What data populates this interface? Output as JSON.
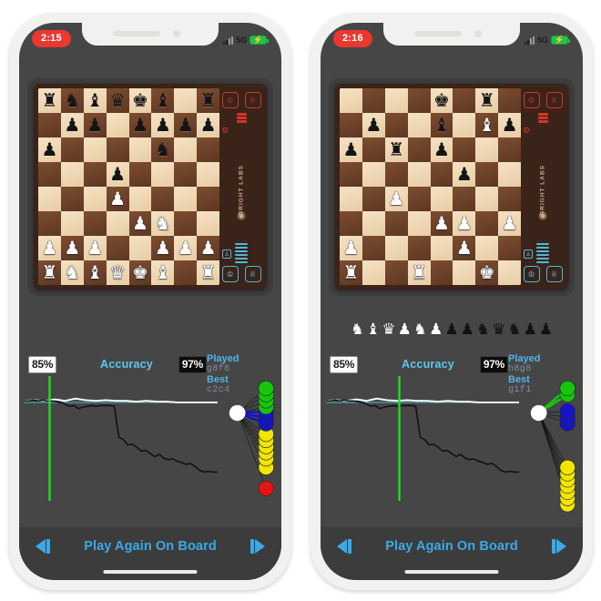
{
  "app": {
    "title": "Chess Game Analysis",
    "background_color": "#ffffff",
    "screen_color": "#464646",
    "accent_color": "#3aa9e8",
    "board_brand": "BRIGHT LABS"
  },
  "phones": [
    {
      "id": "left",
      "status_bar": {
        "time": "2:15",
        "time_pill_color": "#e8382f",
        "network": "5G",
        "battery_icon": "battery-charging-icon",
        "battery_color": "#25c24b",
        "signal_icon": "signal-bars-icon"
      },
      "board": {
        "brand": "BRIGHT LABS",
        "top_leds": [
          "black-king-led",
          "black-queen-led"
        ],
        "bottom_leds": [
          "white-king-led",
          "white-queen-led"
        ],
        "rows": [
          [
            "r",
            "n",
            "b",
            "q",
            "k",
            "b",
            "",
            "r"
          ],
          [
            "",
            "p",
            "p",
            "",
            "p",
            "p",
            "p",
            "p"
          ],
          [
            "p",
            "",
            "",
            "",
            "",
            "n",
            "",
            ""
          ],
          [
            "",
            "",
            "",
            "p",
            "",
            "",
            "",
            ""
          ],
          [
            "",
            "",
            "",
            "P",
            "",
            "",
            "",
            ""
          ],
          [
            "",
            "",
            "",
            "",
            "P",
            "N",
            "",
            ""
          ],
          [
            "P",
            "P",
            "P",
            "",
            "",
            "P",
            "P",
            "P"
          ],
          [
            "R",
            "N",
            "B",
            "Q",
            "K",
            "B",
            "",
            "R"
          ]
        ]
      },
      "captured": [],
      "analysis": {
        "white_accuracy": "85%",
        "black_accuracy": "97%",
        "accuracy_label": "Accuracy",
        "played_label": "Played",
        "played_move": "g8f6",
        "best_label": "Best",
        "best_move": "c2c4",
        "marker_position_pct": 13,
        "marker_color": "#22dd22",
        "zero_line_color": "#4aa9b5"
      },
      "chart_data": {
        "type": "line",
        "title": "Accuracy",
        "xlabel": "",
        "ylabel": "Evaluation",
        "ylim": [
          -1,
          1
        ],
        "grid": false,
        "legend_position": "none",
        "annotations": [
          {
            "text": "85%",
            "type": "white-accuracy-badge"
          },
          {
            "text": "97%",
            "type": "black-accuracy-badge"
          }
        ],
        "series": [
          {
            "name": "white-eval-line",
            "color": "#ffffff",
            "values": [
              0.02,
              0.03,
              0.02,
              0.04,
              0.02,
              0.05,
              0.03,
              0.02,
              0.03,
              0.02,
              0.02,
              0.01,
              0.02,
              0.01,
              0.01,
              0.0,
              0.0,
              0.0,
              0.0,
              0.0
            ]
          },
          {
            "name": "engine-eval-line",
            "color": "#101010",
            "values": [
              0.02,
              0.02,
              0.03,
              0.02,
              0.03,
              0.02,
              0.02,
              0.01,
              0.0,
              -0.02,
              -0.05,
              -0.04,
              -0.08,
              -0.06,
              -0.05,
              -0.04,
              -0.05,
              -0.04,
              -0.04,
              -0.04,
              -0.05,
              -0.45,
              -0.48,
              -0.55,
              -0.54,
              -0.58,
              -0.63,
              -0.62,
              -0.66,
              -0.7,
              -0.67,
              -0.72,
              -0.74,
              -0.73,
              -0.76,
              -0.78,
              -0.8,
              -0.79,
              -0.83,
              -0.88,
              -0.9,
              -0.89,
              -0.9,
              -0.9
            ]
          }
        ],
        "zero_line": 0
      },
      "move_tree": {
        "root_color": "#ffffff",
        "nodes": [
          {
            "color": "#16c60c",
            "label": "excellent",
            "count": 4,
            "cluster": "top"
          },
          {
            "color": "#1414c8",
            "label": "good",
            "count": 3,
            "cluster": "upper"
          },
          {
            "color": "#f2e500",
            "label": "inaccuracy",
            "count": 5,
            "cluster": "middle"
          },
          {
            "color": "#f2e500",
            "label": "inaccuracy",
            "count": 1,
            "cluster": "lower"
          },
          {
            "color": "#e81313",
            "label": "blunder",
            "count": 1,
            "cluster": "bottom"
          }
        ],
        "highlight_edge_color": "#1414c8"
      },
      "bottom_bar": {
        "prev_label": "step-back",
        "play_label": "Play Again On Board",
        "next_label": "step-forward"
      }
    },
    {
      "id": "right",
      "status_bar": {
        "time": "2:16",
        "time_pill_color": "#e8382f",
        "network": "5G",
        "battery_icon": "battery-charging-icon",
        "battery_color": "#25c24b",
        "signal_icon": "signal-bars-icon"
      },
      "board": {
        "brand": "BRIGHT LABS",
        "top_leds": [
          "black-king-led",
          "black-queen-led"
        ],
        "bottom_leds": [
          "white-king-led",
          "white-queen-led"
        ],
        "rows": [
          [
            "",
            "",
            "",
            "",
            "k",
            "",
            "r",
            ""
          ],
          [
            "",
            "p",
            "",
            "",
            "b",
            "",
            "B",
            "p"
          ],
          [
            "p",
            "",
            "r",
            "",
            "p",
            "",
            "",
            ""
          ],
          [
            "",
            "",
            "",
            "",
            "",
            "p",
            "",
            ""
          ],
          [
            "",
            "",
            "P",
            "",
            "",
            "",
            "",
            ""
          ],
          [
            "",
            "",
            "",
            "",
            "P",
            "P",
            "",
            "P"
          ],
          [
            "P",
            "",
            "",
            "",
            "",
            "P",
            "",
            ""
          ],
          [
            "R",
            "",
            "",
            "R",
            "",
            "",
            "K",
            ""
          ]
        ]
      },
      "captured": [
        {
          "piece": "white-knight",
          "glyph": "N"
        },
        {
          "piece": "white-bishop",
          "glyph": "B"
        },
        {
          "piece": "white-queen",
          "glyph": "Q"
        },
        {
          "piece": "white-pawn",
          "glyph": "P"
        },
        {
          "piece": "white-knight",
          "glyph": "N"
        },
        {
          "piece": "white-pawn",
          "glyph": "P"
        },
        {
          "piece": "black-pawn",
          "glyph": "p"
        },
        {
          "piece": "black-pawn",
          "glyph": "p"
        },
        {
          "piece": "black-knight",
          "glyph": "n"
        },
        {
          "piece": "black-queen",
          "glyph": "q"
        },
        {
          "piece": "black-knight",
          "glyph": "n"
        },
        {
          "piece": "black-pawn",
          "glyph": "p"
        },
        {
          "piece": "black-pawn",
          "glyph": "p"
        }
      ],
      "analysis": {
        "white_accuracy": "85%",
        "black_accuracy": "97%",
        "accuracy_label": "Accuracy",
        "played_label": "Played",
        "played_move": "h8g8",
        "best_label": "Best",
        "best_move": "g1f1",
        "marker_position_pct": 38,
        "marker_color": "#22dd22",
        "zero_line_color": "#4aa9b5"
      },
      "chart_data": {
        "type": "line",
        "title": "Accuracy",
        "xlabel": "",
        "ylabel": "Evaluation",
        "ylim": [
          -1,
          1
        ],
        "grid": false,
        "legend_position": "none",
        "annotations": [
          {
            "text": "85%",
            "type": "white-accuracy-badge"
          },
          {
            "text": "97%",
            "type": "black-accuracy-badge"
          }
        ],
        "series": [
          {
            "name": "white-eval-line",
            "color": "#ffffff",
            "values": [
              0.02,
              0.03,
              0.02,
              0.04,
              0.02,
              0.05,
              0.03,
              0.02,
              0.03,
              0.02,
              0.02,
              0.01,
              0.02,
              0.01,
              0.01,
              0.0,
              0.0,
              0.0,
              0.0,
              0.0
            ]
          },
          {
            "name": "engine-eval-line",
            "color": "#101010",
            "values": [
              0.02,
              0.02,
              0.03,
              0.02,
              0.03,
              0.02,
              0.02,
              0.01,
              0.0,
              -0.02,
              -0.05,
              -0.04,
              -0.08,
              -0.06,
              -0.05,
              -0.04,
              -0.05,
              -0.04,
              -0.04,
              -0.04,
              -0.05,
              -0.45,
              -0.48,
              -0.55,
              -0.54,
              -0.58,
              -0.63,
              -0.62,
              -0.66,
              -0.7,
              -0.67,
              -0.72,
              -0.74,
              -0.73,
              -0.76,
              -0.78,
              -0.8,
              -0.79,
              -0.83,
              -0.88,
              -0.9,
              -0.89,
              -0.9,
              -0.9
            ]
          }
        ],
        "zero_line": 0
      },
      "move_tree": {
        "root_color": "#ffffff",
        "nodes": [
          {
            "color": "#16c60c",
            "label": "excellent",
            "count": 2,
            "cluster": "top"
          },
          {
            "color": "#1414c8",
            "label": "good",
            "count": 3,
            "cluster": "upper"
          },
          {
            "color": "#f2e500",
            "label": "inaccuracy",
            "count": 7,
            "cluster": "lower"
          }
        ],
        "highlight_edge_color": "#16c60c"
      },
      "bottom_bar": {
        "prev_label": "step-back",
        "play_label": "Play Again On Board",
        "next_label": "step-forward"
      }
    }
  ]
}
